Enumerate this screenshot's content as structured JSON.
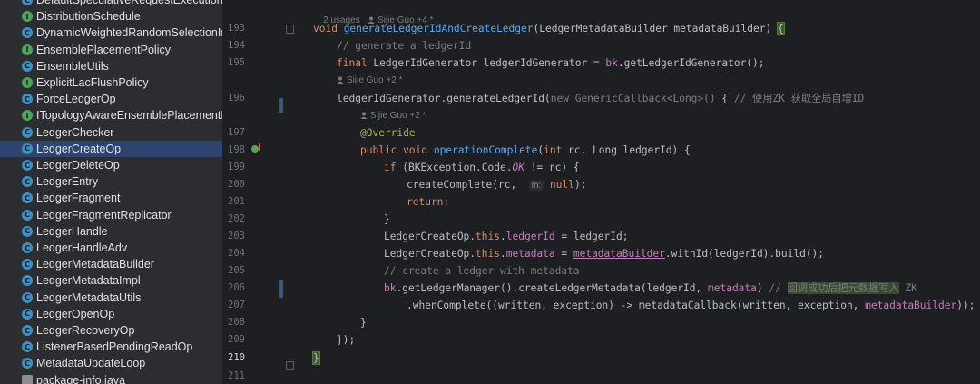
{
  "sidebar": {
    "items": [
      {
        "label": "DefaultSpeculativeRequestExecution",
        "icon": "class-icon"
      },
      {
        "label": "DistributionSchedule",
        "icon": "interface-icon"
      },
      {
        "label": "DynamicWeightedRandomSelectionIn",
        "icon": "class-icon"
      },
      {
        "label": "EnsemblePlacementPolicy",
        "icon": "interface-icon"
      },
      {
        "label": "EnsembleUtils",
        "icon": "class-icon"
      },
      {
        "label": "ExplicitLacFlushPolicy",
        "icon": "interface-icon"
      },
      {
        "label": "ForceLedgerOp",
        "icon": "class-icon"
      },
      {
        "label": "ITopologyAwareEnsemblePlacementP",
        "icon": "interface-icon"
      },
      {
        "label": "LedgerChecker",
        "icon": "class-icon"
      },
      {
        "label": "LedgerCreateOp",
        "icon": "class-icon",
        "selected": true
      },
      {
        "label": "LedgerDeleteOp",
        "icon": "class-icon"
      },
      {
        "label": "LedgerEntry",
        "icon": "class-icon"
      },
      {
        "label": "LedgerFragment",
        "icon": "class-icon"
      },
      {
        "label": "LedgerFragmentReplicator",
        "icon": "class-icon"
      },
      {
        "label": "LedgerHandle",
        "icon": "class-icon"
      },
      {
        "label": "LedgerHandleAdv",
        "icon": "class-icon"
      },
      {
        "label": "LedgerMetadataBuilder",
        "icon": "class-icon"
      },
      {
        "label": "LedgerMetadataImpl",
        "icon": "class-icon"
      },
      {
        "label": "LedgerMetadataUtils",
        "icon": "class-icon"
      },
      {
        "label": "LedgerOpenOp",
        "icon": "class-icon"
      },
      {
        "label": "LedgerRecoveryOp",
        "icon": "class-icon"
      },
      {
        "label": "ListenerBasedPendingReadOp",
        "icon": "class-icon"
      },
      {
        "label": "MetadataUpdateLoop",
        "icon": "class-icon"
      },
      {
        "label": "package-info.java",
        "icon": "file-icon"
      }
    ]
  },
  "gutter": {
    "line_numbers": [
      "193",
      "194",
      "195",
      "196",
      "197",
      "198",
      "199",
      "200",
      "201",
      "202",
      "203",
      "204",
      "205",
      "206",
      "207",
      "208",
      "209",
      "210",
      "211"
    ],
    "current_line": "210"
  },
  "editor": {
    "hints": {
      "usages": "2 usages",
      "author_top": "Sijie Guo +4 *",
      "author_2": "Sijie Guo +2 *",
      "author_3": "Sijie Guo +2 *"
    },
    "lines": {
      "l193": {
        "kw": "void ",
        "fn": "generateLedgerIdAndCreateLedger",
        "rest": "(LedgerMetadataBuilder metadataBuilder) ",
        "brace": "{"
      },
      "l194": "// generate a ledgerId",
      "l195": {
        "kw": "final ",
        "rest1": "LedgerIdGenerator ledgerIdGenerator = ",
        "field": "bk",
        "rest2": ".getLedgerIdGenerator();"
      },
      "l196": {
        "rest1": "ledgerIdGenerator.generateLedgerId(",
        "kw": "new ",
        "gen": "GenericCallback<Long>() ",
        "rest2": "{ ",
        "cmt": "// 使用ZK 获取全局自增ID"
      },
      "l197": "@Override",
      "l198": {
        "kw": "public void ",
        "fn": "operationComplete",
        "rest1": "(",
        "kw2": "int ",
        "rest2": "rc, Long ledgerId) {"
      },
      "l199": {
        "kw": "if ",
        "rest1": "(BKException.Code.",
        "static": "OK",
        "rest2": " != rc) {"
      },
      "l200": {
        "rest1": "createComplete(rc,  ",
        "hint": "lh:",
        "kw": " null",
        "rest2": ");"
      },
      "l201": "return;",
      "l202": "}",
      "l203": {
        "rest1": "LedgerCreateOp.",
        "kw": "this",
        "rest2": ".",
        "field": "ledgerId",
        "rest3": " = ledgerId;"
      },
      "l204": {
        "rest1": "LedgerCreateOp.",
        "kw": "this",
        "rest2": ".",
        "field": "metadata",
        "rest3": " = ",
        "ul": "metadataBuilder",
        "rest4": ".withId(ledgerId).build();"
      },
      "l205": "// create a ledger with metadata",
      "l206": {
        "field": "bk",
        "rest1": ".getLedgerManager().createLedgerMetadata(ledgerId, ",
        "field2": "metadata",
        "rest2": ") ",
        "cmt": "// ",
        "cn": "回调成功后把元数据写入",
        "cmt2": " ZK"
      },
      "l207": {
        "rest1": ".whenComplete((written, exception) -> metadataCallback(written, exception, ",
        "ul": "metadataBuilder",
        "rest2": "));"
      },
      "l208": "}",
      "l209": "});",
      "l210": "}"
    }
  },
  "colors": {
    "background": "#1e1f22",
    "sidebar": "#2b2d30",
    "selected": "#2e436e",
    "keyword": "#cf8e6d",
    "function": "#56a8f5",
    "field": "#c77dbb",
    "comment": "#7a7e85",
    "annotation": "#b3ae60"
  }
}
